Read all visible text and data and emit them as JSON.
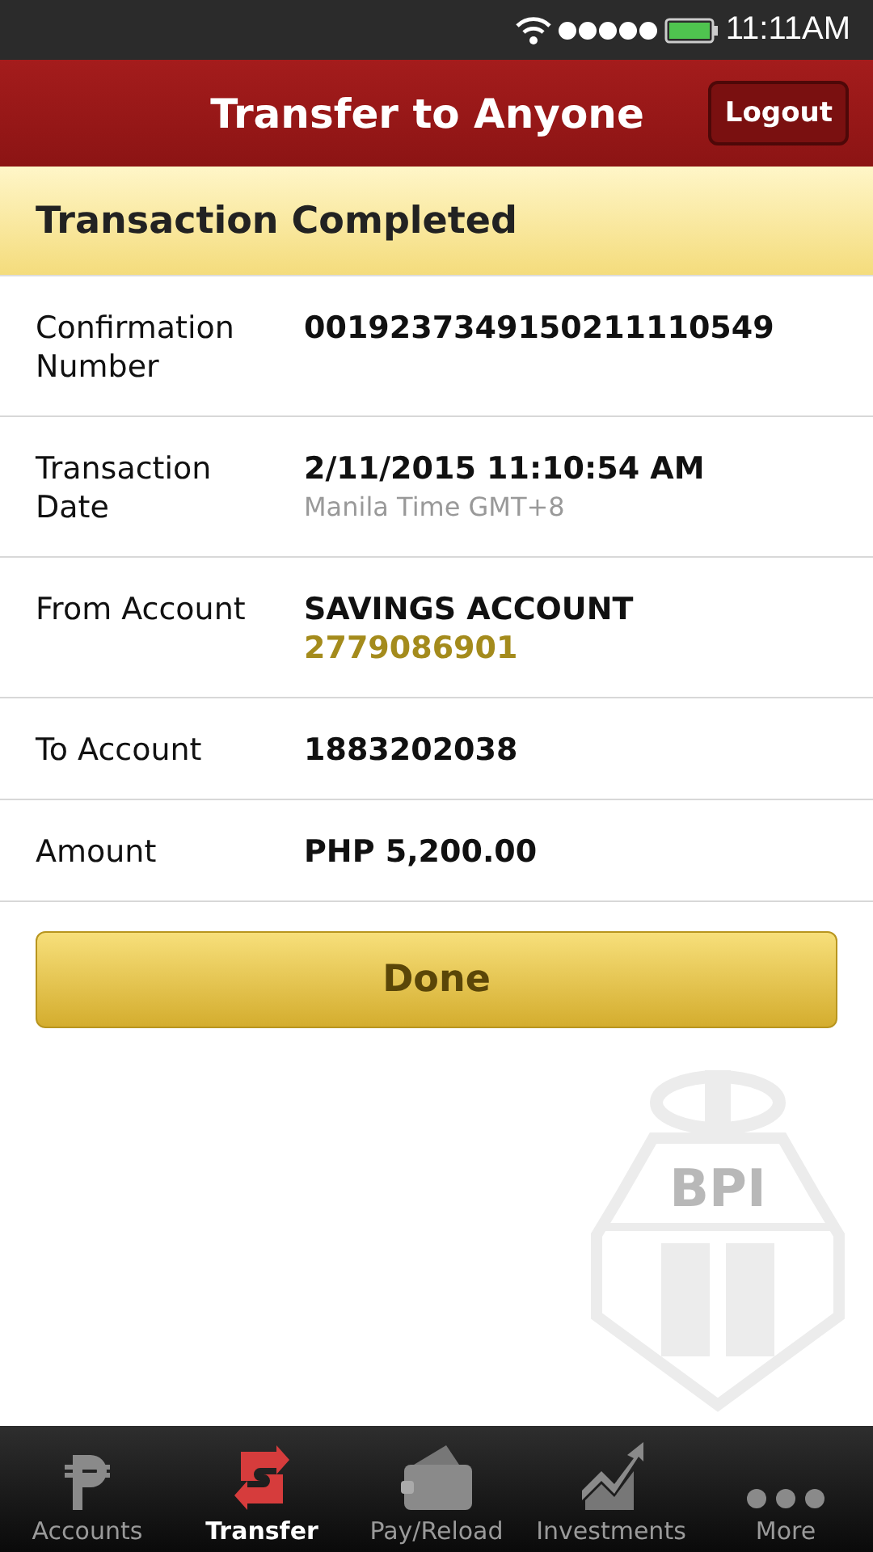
{
  "status_bar": {
    "time": "11:11AM"
  },
  "header": {
    "title": "Transfer to Anyone",
    "logout": "Logout"
  },
  "banner": "Transaction Completed",
  "details": [
    {
      "label": "Confirmation Number",
      "lines": [
        {
          "text": "0019237349150211110549",
          "kind": "main"
        }
      ]
    },
    {
      "label": "Transaction Date",
      "lines": [
        {
          "text": "2/11/2015 11:10:54 AM",
          "kind": "main"
        },
        {
          "text": "Manila Time GMT+8",
          "kind": "note"
        }
      ]
    },
    {
      "label": "From Account",
      "lines": [
        {
          "text": "SAVINGS ACCOUNT",
          "kind": "main"
        },
        {
          "text": "2779086901",
          "kind": "number"
        }
      ]
    },
    {
      "label": "To Account",
      "lines": [
        {
          "text": "1883202038",
          "kind": "main"
        }
      ]
    },
    {
      "label": "Amount",
      "lines": [
        {
          "text": "PHP 5,200.00",
          "kind": "main"
        }
      ]
    }
  ],
  "done_button": "Done",
  "emblem_text": "BPI",
  "nav": [
    {
      "label": "Accounts",
      "kind": "peso",
      "selected": false
    },
    {
      "label": "Transfer",
      "kind": "transfer",
      "selected": true
    },
    {
      "label": "Pay/Reload",
      "kind": "wallet",
      "selected": false
    },
    {
      "label": "Investments",
      "kind": "chart",
      "selected": false
    },
    {
      "label": "More",
      "kind": "more",
      "selected": false
    }
  ]
}
